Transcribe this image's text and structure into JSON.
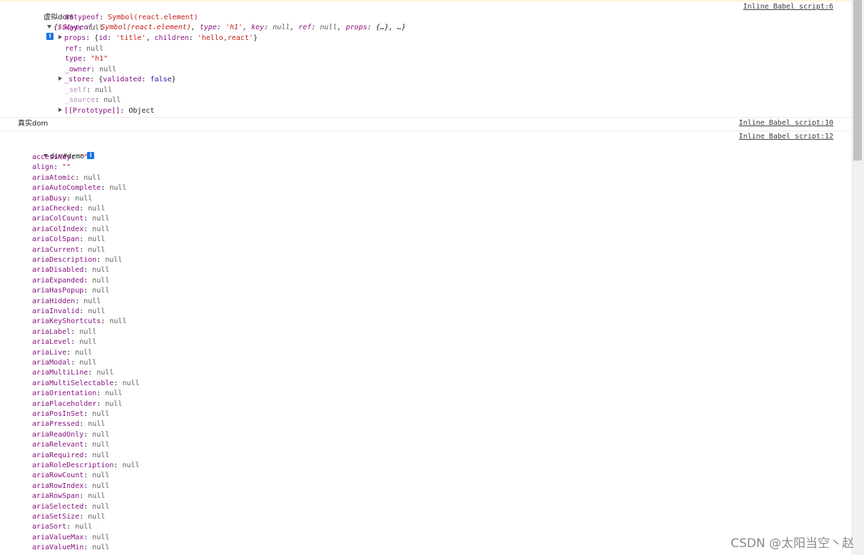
{
  "messages": {
    "vdom": {
      "label": "虚拟dom",
      "source": "Inline Babel script:6",
      "summary_prefix": "{",
      "summary": [
        {
          "k": "$$typeof",
          "v": "Symbol(react.element)",
          "vt": "str"
        },
        {
          "k": "type",
          "v": "'h1'",
          "vt": "str"
        },
        {
          "k": "key",
          "v": "null",
          "vt": "nul"
        },
        {
          "k": "ref",
          "v": "null",
          "vt": "nul"
        },
        {
          "k": "props",
          "v": "{…}",
          "vt": "plain"
        }
      ],
      "summary_suffix": "…}",
      "props": [
        {
          "key": "$$typeof",
          "value": "Symbol(react.element)",
          "vt": "str",
          "expand": "",
          "dim": false
        },
        {
          "key": "key",
          "value": "null",
          "vt": "nul",
          "expand": "",
          "dim": false
        },
        {
          "key": "props",
          "value": "{id: 'title', children: 'hello,react'}",
          "vt": "props",
          "expand": "right",
          "dim": false
        },
        {
          "key": "ref",
          "value": "null",
          "vt": "nul",
          "expand": "",
          "dim": false
        },
        {
          "key": "type",
          "value": "\"h1\"",
          "vt": "str",
          "expand": "",
          "dim": false
        },
        {
          "key": "_owner",
          "value": "null",
          "vt": "nul",
          "expand": "",
          "dim": false
        },
        {
          "key": "_store",
          "value": "{validated: false}",
          "vt": "store",
          "expand": "right",
          "dim": false
        },
        {
          "key": "_self",
          "value": "null",
          "vt": "nul",
          "expand": "",
          "dim": true
        },
        {
          "key": "_source",
          "value": "null",
          "vt": "nul",
          "expand": "",
          "dim": true
        },
        {
          "key": "[[Prototype]]",
          "value": "Object",
          "vt": "plain",
          "expand": "right",
          "dim": false
        }
      ]
    },
    "real": {
      "label": "真实dom",
      "source": "Inline Babel script:10"
    },
    "dom": {
      "source": "Inline Babel script:12",
      "label": "div#demo",
      "props": [
        {
          "key": "accessKey",
          "value": "\"\"",
          "vt": "str"
        },
        {
          "key": "align",
          "value": "\"\"",
          "vt": "str"
        },
        {
          "key": "ariaAtomic",
          "value": "null",
          "vt": "nul"
        },
        {
          "key": "ariaAutoComplete",
          "value": "null",
          "vt": "nul"
        },
        {
          "key": "ariaBusy",
          "value": "null",
          "vt": "nul"
        },
        {
          "key": "ariaChecked",
          "value": "null",
          "vt": "nul"
        },
        {
          "key": "ariaColCount",
          "value": "null",
          "vt": "nul"
        },
        {
          "key": "ariaColIndex",
          "value": "null",
          "vt": "nul"
        },
        {
          "key": "ariaColSpan",
          "value": "null",
          "vt": "nul"
        },
        {
          "key": "ariaCurrent",
          "value": "null",
          "vt": "nul"
        },
        {
          "key": "ariaDescription",
          "value": "null",
          "vt": "nul"
        },
        {
          "key": "ariaDisabled",
          "value": "null",
          "vt": "nul"
        },
        {
          "key": "ariaExpanded",
          "value": "null",
          "vt": "nul"
        },
        {
          "key": "ariaHasPopup",
          "value": "null",
          "vt": "nul"
        },
        {
          "key": "ariaHidden",
          "value": "null",
          "vt": "nul"
        },
        {
          "key": "ariaInvalid",
          "value": "null",
          "vt": "nul"
        },
        {
          "key": "ariaKeyShortcuts",
          "value": "null",
          "vt": "nul"
        },
        {
          "key": "ariaLabel",
          "value": "null",
          "vt": "nul"
        },
        {
          "key": "ariaLevel",
          "value": "null",
          "vt": "nul"
        },
        {
          "key": "ariaLive",
          "value": "null",
          "vt": "nul"
        },
        {
          "key": "ariaModal",
          "value": "null",
          "vt": "nul"
        },
        {
          "key": "ariaMultiLine",
          "value": "null",
          "vt": "nul"
        },
        {
          "key": "ariaMultiSelectable",
          "value": "null",
          "vt": "nul"
        },
        {
          "key": "ariaOrientation",
          "value": "null",
          "vt": "nul"
        },
        {
          "key": "ariaPlaceholder",
          "value": "null",
          "vt": "nul"
        },
        {
          "key": "ariaPosInSet",
          "value": "null",
          "vt": "nul"
        },
        {
          "key": "ariaPressed",
          "value": "null",
          "vt": "nul"
        },
        {
          "key": "ariaReadOnly",
          "value": "null",
          "vt": "nul"
        },
        {
          "key": "ariaRelevant",
          "value": "null",
          "vt": "nul"
        },
        {
          "key": "ariaRequired",
          "value": "null",
          "vt": "nul"
        },
        {
          "key": "ariaRoleDescription",
          "value": "null",
          "vt": "nul"
        },
        {
          "key": "ariaRowCount",
          "value": "null",
          "vt": "nul"
        },
        {
          "key": "ariaRowIndex",
          "value": "null",
          "vt": "nul"
        },
        {
          "key": "ariaRowSpan",
          "value": "null",
          "vt": "nul"
        },
        {
          "key": "ariaSelected",
          "value": "null",
          "vt": "nul"
        },
        {
          "key": "ariaSetSize",
          "value": "null",
          "vt": "nul"
        },
        {
          "key": "ariaSort",
          "value": "null",
          "vt": "nul"
        },
        {
          "key": "ariaValueMax",
          "value": "null",
          "vt": "nul"
        },
        {
          "key": "ariaValueMin",
          "value": "null",
          "vt": "nul"
        }
      ]
    }
  },
  "watermark": "CSDN @太阳当空丶赵",
  "icons": {
    "info": "i",
    "expanded": "triangle-down-icon",
    "collapsed": "triangle-right-icon"
  },
  "colors": {
    "key": "#881280",
    "string": "#c41a16",
    "null": "#5e5e5e",
    "keyword": "#1a1aa6",
    "info_badge": "#1a73e8"
  }
}
